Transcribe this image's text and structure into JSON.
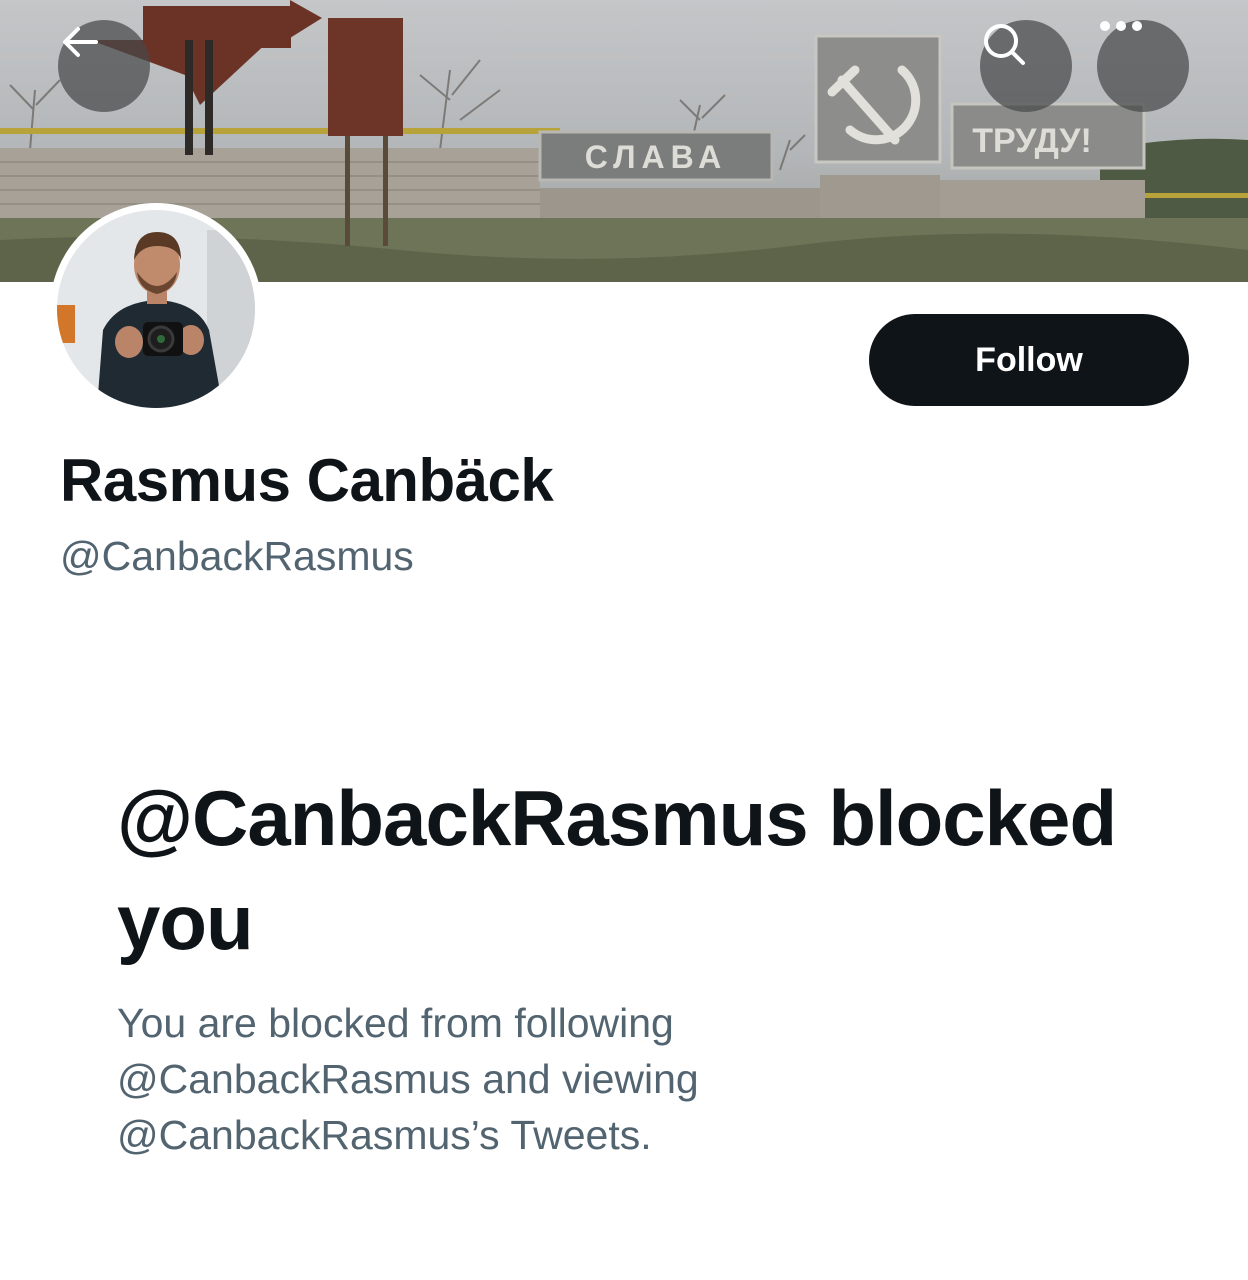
{
  "banner": {
    "sign_left_text": "СЛАВА",
    "sign_right_text": "ТРУДУ!"
  },
  "icons": {
    "back": "arrow-left-icon",
    "search": "search-icon",
    "more": "more-horizontal-icon"
  },
  "profile": {
    "display_name": "Rasmus Canbäck",
    "handle": "@CanbackRasmus",
    "follow_label": "Follow"
  },
  "blocked": {
    "title": "@CanbackRasmus blocked you",
    "description": "You are blocked from following @CanbackRasmus and viewing @CanbackRasmus’s Tweets."
  },
  "colors": {
    "primary_text": "#0f1419",
    "secondary_text": "#536471",
    "follow_button_bg": "#0f1419",
    "follow_button_text": "#ffffff"
  }
}
